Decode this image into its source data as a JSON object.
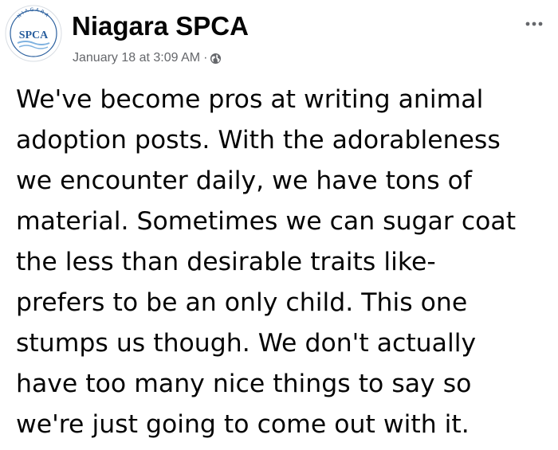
{
  "post": {
    "page_name": "Niagara SPCA",
    "avatar": {
      "arc_text": "NIAGARA",
      "logo_text": "SPCA"
    },
    "timestamp": "January 18 at 3:09 AM",
    "separator": "·",
    "privacy_icon": "globe-icon",
    "more_icon": "more-options-icon",
    "text_lines": [
      "We've become pros at writing animal",
      "adoption posts. With the adorableness",
      "we encounter daily, we have tons of",
      "material. Sometimes we can sugar coat",
      "the less than desirable traits like-",
      "prefers to be an only child. This one",
      "stumps us though. We don't actually",
      "have too many nice things to say so",
      "we're just going to come out with it."
    ]
  },
  "colors": {
    "text_primary": "#050505",
    "text_secondary": "#65676b",
    "logo_blue": "#2a5f9e",
    "logo_light_blue": "#7fb2e0",
    "background": "#ffffff"
  }
}
